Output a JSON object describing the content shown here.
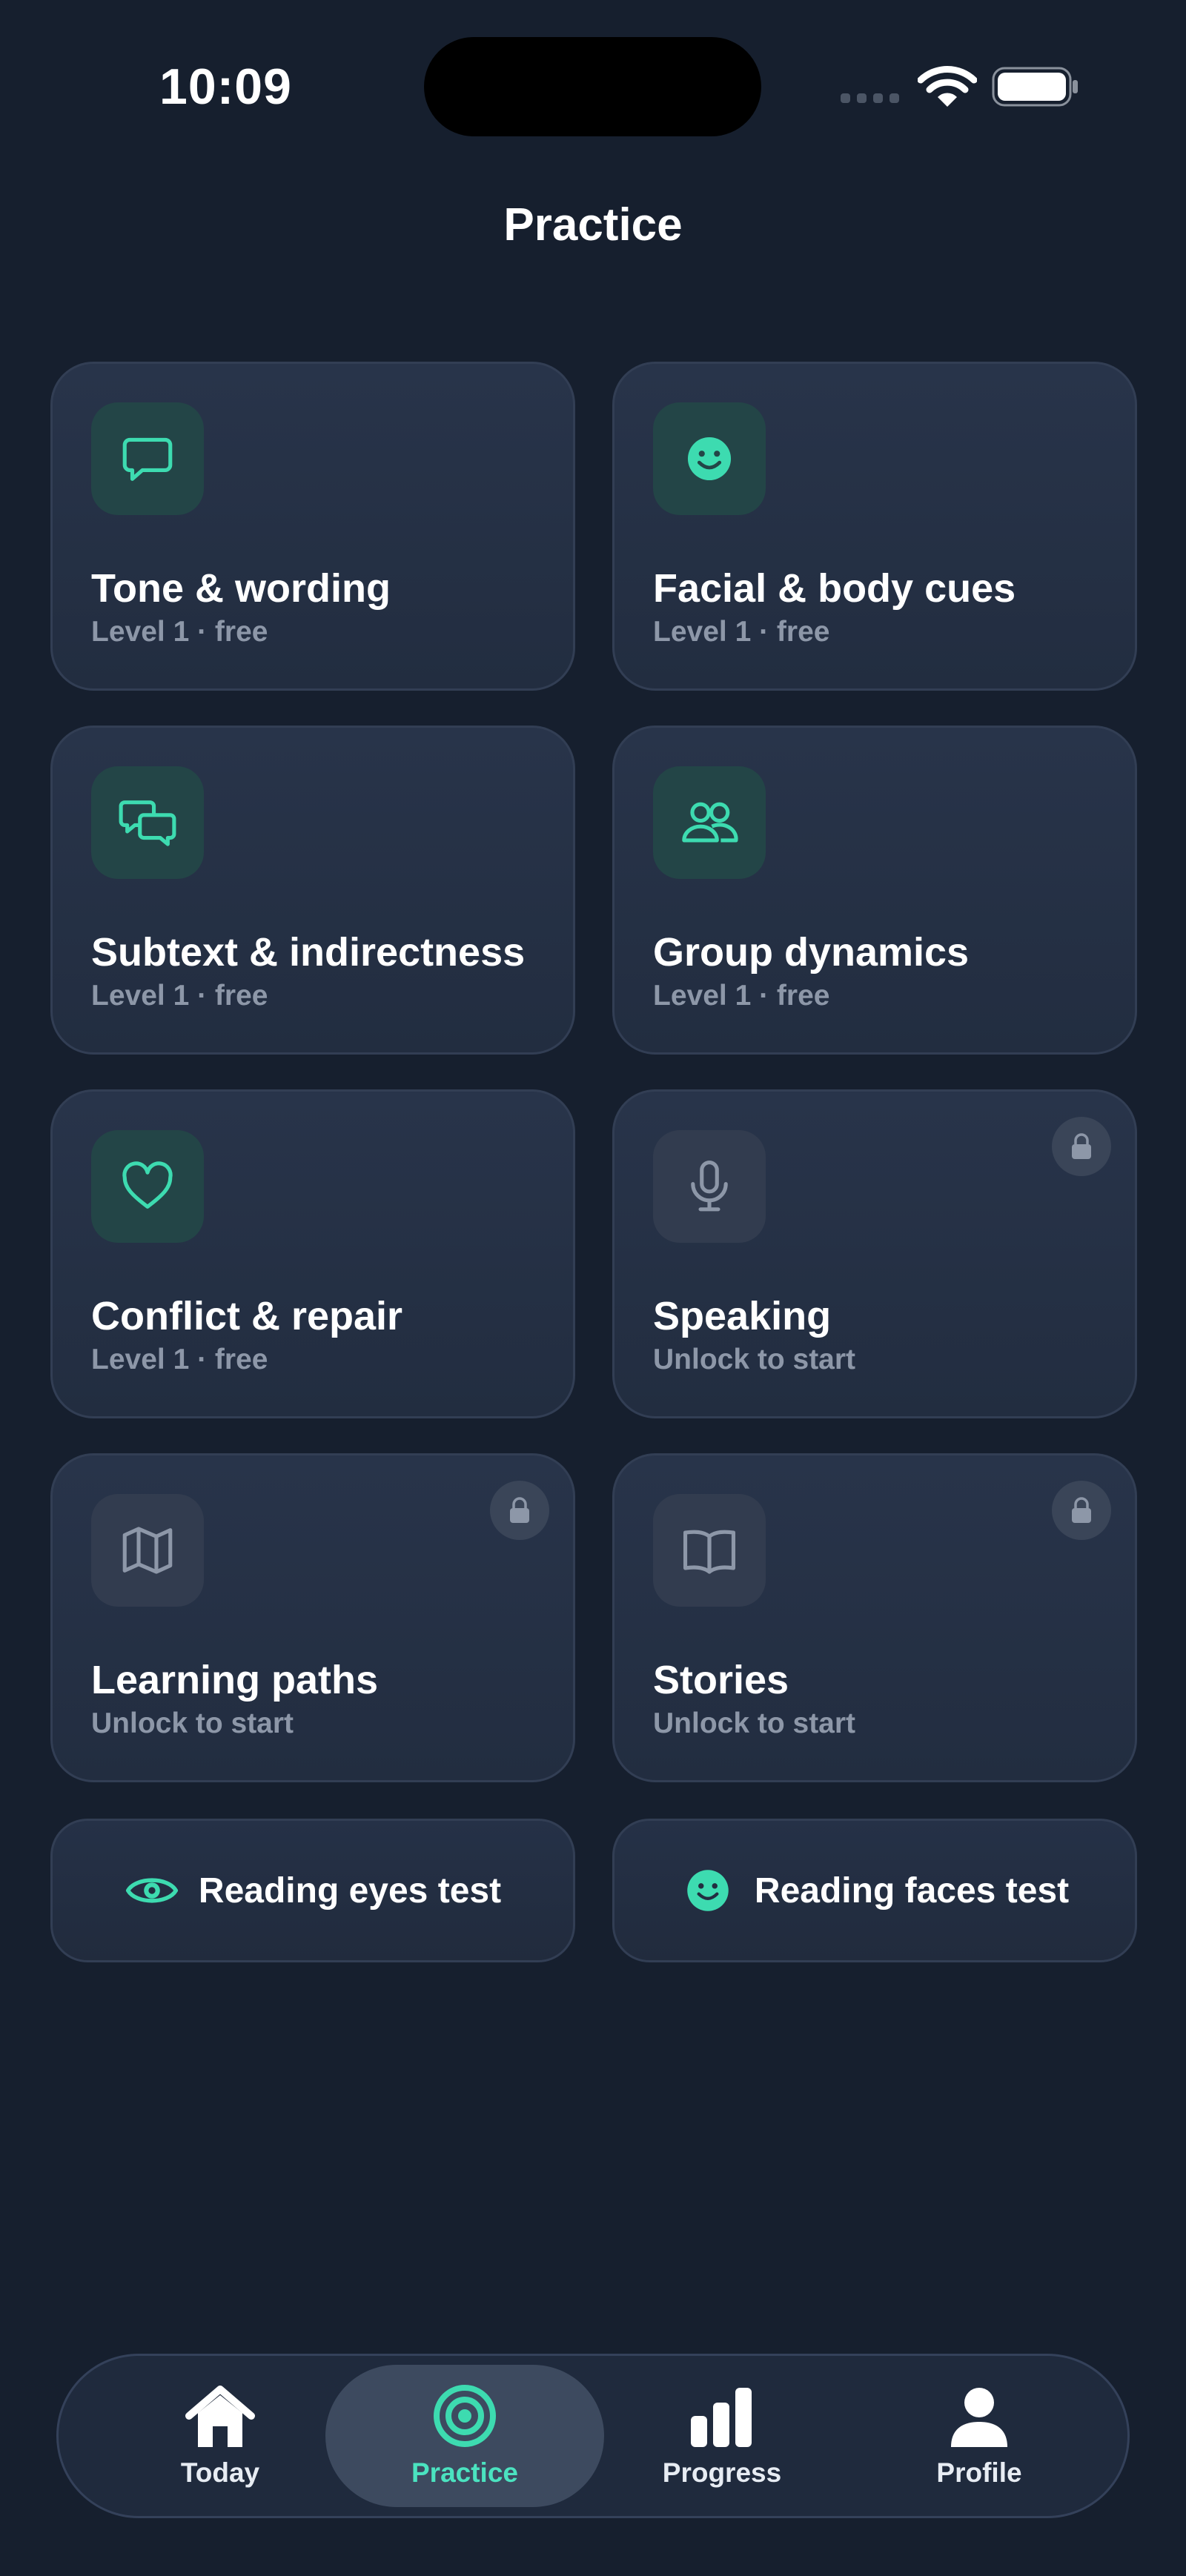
{
  "status_bar": {
    "time": "10:09"
  },
  "header": {
    "title": "Practice"
  },
  "colors": {
    "accent": "#3ddbb0",
    "background": "#161f2e",
    "card": "#263248",
    "muted_text": "#8d97a8"
  },
  "cards": [
    {
      "title": "Tone & wording",
      "subtitle": "Level 1 · free",
      "icon": "speech-bubble-icon",
      "locked": false
    },
    {
      "title": "Facial & body cues",
      "subtitle": "Level 1 · free",
      "icon": "smiley-face-icon",
      "locked": false
    },
    {
      "title": "Subtext & indirectness",
      "subtitle": "Level 1 · free",
      "icon": "chat-bubbles-icon",
      "locked": false
    },
    {
      "title": "Group dynamics",
      "subtitle": "Level 1 · free",
      "icon": "people-icon",
      "locked": false
    },
    {
      "title": "Conflict & repair",
      "subtitle": "Level 1 · free",
      "icon": "heart-icon",
      "locked": false
    },
    {
      "title": "Speaking",
      "subtitle": "Unlock to start",
      "icon": "microphone-icon",
      "locked": true
    },
    {
      "title": "Learning paths",
      "subtitle": "Unlock to start",
      "icon": "map-icon",
      "locked": true
    },
    {
      "title": "Stories",
      "subtitle": "Unlock to start",
      "icon": "open-book-icon",
      "locked": true
    }
  ],
  "tests": [
    {
      "label": "Reading eyes test",
      "icon": "eye-icon"
    },
    {
      "label": "Reading faces test",
      "icon": "smiley-face-icon"
    }
  ],
  "tab_bar": {
    "active": "Practice",
    "tabs": [
      {
        "label": "Today",
        "icon": "house-icon"
      },
      {
        "label": "Practice",
        "icon": "target-icon"
      },
      {
        "label": "Progress",
        "icon": "bar-chart-icon"
      },
      {
        "label": "Profile",
        "icon": "person-icon"
      }
    ]
  }
}
